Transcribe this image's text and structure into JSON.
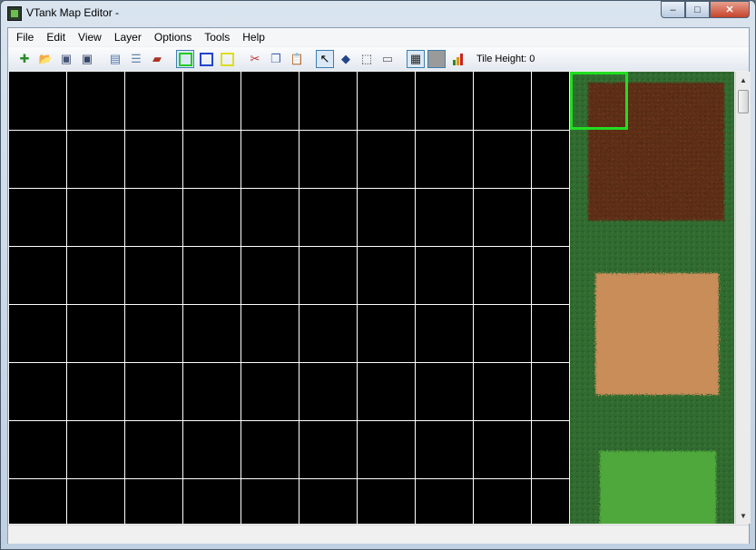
{
  "window": {
    "title": "VTank Map Editor -",
    "controls": {
      "minimize": "–",
      "maximize": "□",
      "close": "✕"
    }
  },
  "menu": [
    "File",
    "Edit",
    "View",
    "Layer",
    "Options",
    "Tools",
    "Help"
  ],
  "toolbar": {
    "buttons": [
      {
        "name": "new-map",
        "icon": "new-file-icon",
        "glyph": "✚",
        "color": "#2a8a2a"
      },
      {
        "name": "open-map",
        "icon": "open-folder-icon",
        "glyph": "📂",
        "color": "#b58a28"
      },
      {
        "name": "save-as",
        "icon": "save-as-icon",
        "glyph": "▣",
        "color": "#445577"
      },
      {
        "name": "save",
        "icon": "save-icon",
        "glyph": "▣",
        "color": "#334466"
      },
      {
        "name": "properties",
        "icon": "properties-icon",
        "glyph": "▤",
        "color": "#5577aa"
      },
      {
        "name": "list",
        "icon": "list-icon",
        "glyph": "☰",
        "color": "#6688aa"
      },
      {
        "name": "tank",
        "icon": "tank-icon",
        "glyph": "▰",
        "color": "#aa3322"
      },
      {
        "name": "cut",
        "icon": "cut-icon",
        "glyph": "✂",
        "color": "#c03030"
      },
      {
        "name": "copy",
        "icon": "copy-icon",
        "glyph": "❐",
        "color": "#4466aa"
      },
      {
        "name": "paste",
        "icon": "paste-icon",
        "glyph": "📋",
        "color": "#887744"
      },
      {
        "name": "select-tool",
        "icon": "pointer-icon",
        "glyph": "↖",
        "color": "#000000"
      },
      {
        "name": "fill-tool",
        "icon": "paint-bucket-icon",
        "glyph": "◆",
        "color": "#224488"
      },
      {
        "name": "marquee-tool",
        "icon": "marquee-icon",
        "glyph": "⬚",
        "color": "#333333"
      },
      {
        "name": "rectangle-tool",
        "icon": "rectangle-icon",
        "glyph": "▭",
        "color": "#666666"
      },
      {
        "name": "grid-toggle",
        "icon": "grid-icon",
        "glyph": "▦",
        "color": "#222222"
      },
      {
        "name": "layer-toggle",
        "icon": "layer-icon",
        "glyph": "■",
        "color": "#9a9a9a"
      },
      {
        "name": "heights",
        "icon": "bar-chart-icon",
        "glyph": "▮",
        "color": "#cc8800"
      }
    ],
    "layer_colors": [
      "#22cc22",
      "#2244cc",
      "#dddd22"
    ],
    "tile_height_label": "Tile Height: 0"
  },
  "grid": {
    "color": "#ffffff",
    "background": "#000000",
    "columns": 10,
    "rows": 8
  },
  "palette": {
    "tiles": [
      "dirt",
      "sand",
      "grass"
    ],
    "selected_tile": "dirt",
    "selection_color": "#22dd22"
  }
}
